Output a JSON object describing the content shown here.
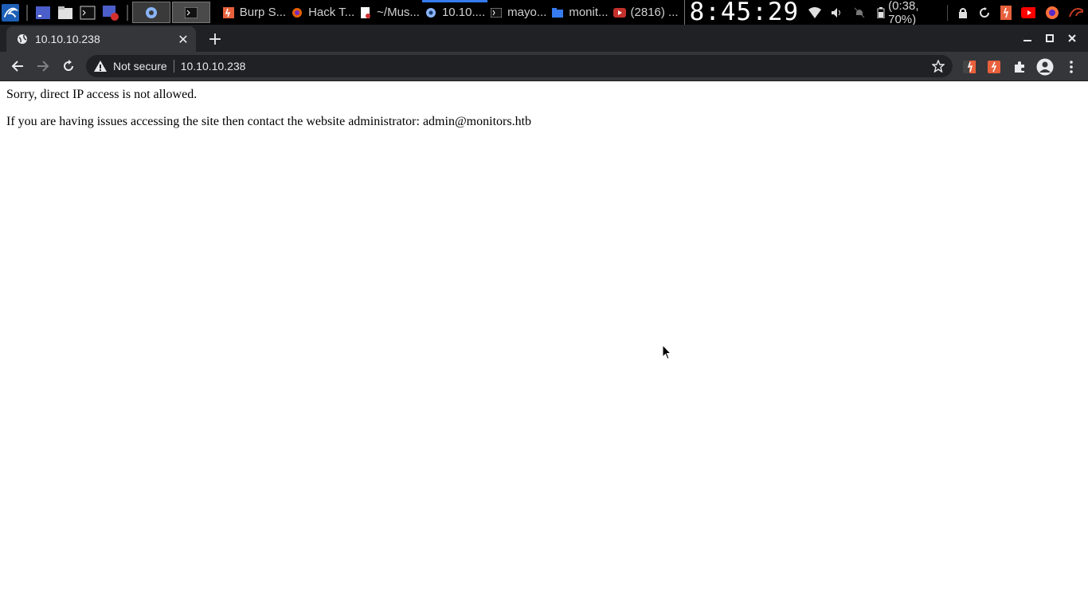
{
  "taskbar": {
    "tasks": [
      {
        "label": "Burp S...",
        "icon": "burp-icon"
      },
      {
        "label": "Hack T...",
        "icon": "firefox-icon"
      },
      {
        "label": "~/Mus...",
        "icon": "document-icon"
      },
      {
        "label": "10.10....",
        "icon": "chrome-icon"
      },
      {
        "label": "mayo...",
        "icon": "terminal-icon"
      },
      {
        "label": "monit...",
        "icon": "folder-icon"
      },
      {
        "label": "(2816) ...",
        "icon": "youtube-icon"
      }
    ],
    "clock": "8:45:29",
    "battery": "(0:38, 70%)"
  },
  "browser": {
    "tab_title": "10.10.10.238",
    "new_tab_symbol": "+",
    "security_label": "Not secure",
    "url": "10.10.10.238"
  },
  "page": {
    "line1": "Sorry, direct IP access is not allowed.",
    "line2": "If you are having issues accessing the site then contact the website administrator: admin@monitors.htb"
  },
  "colors": {
    "taskbar_bg": "#000000",
    "tabstrip_bg": "#202124",
    "active_tab_bg": "#35363a",
    "omnibox_bg": "#202124",
    "accent": "#367bf0"
  }
}
